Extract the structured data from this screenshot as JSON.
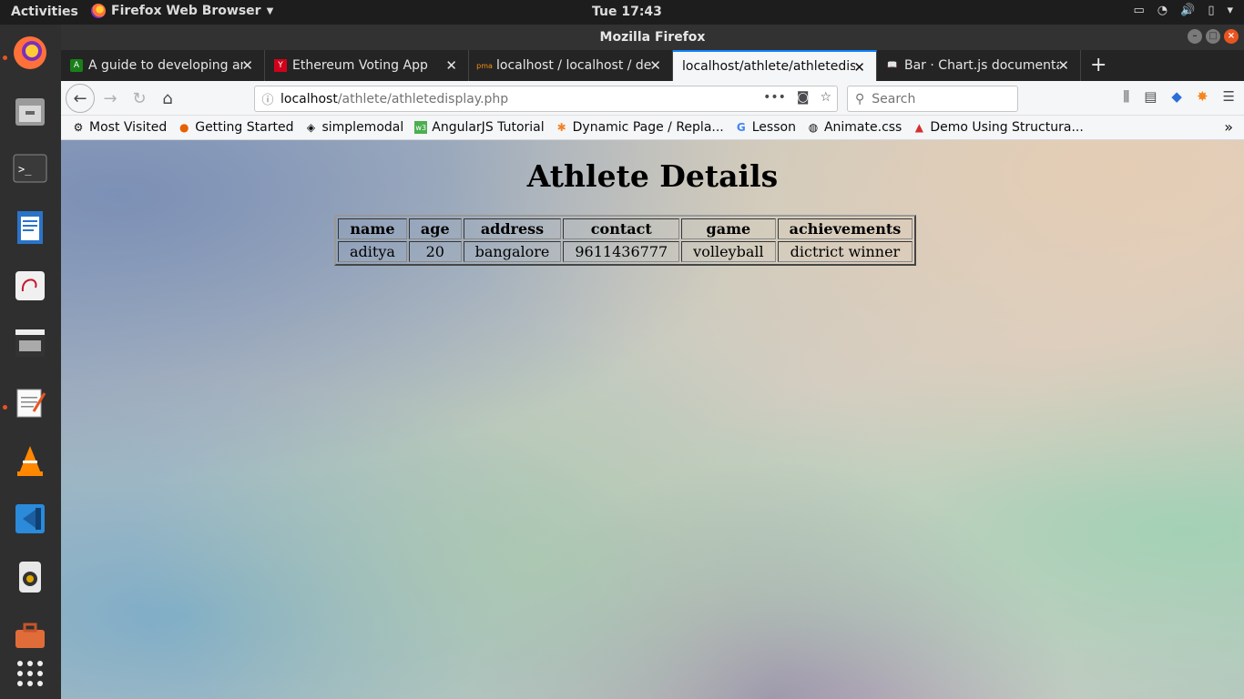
{
  "topbar": {
    "activities": "Activities",
    "app_menu": "Firefox Web Browser",
    "clock": "Tue 17:43"
  },
  "dock": {
    "apps": [
      "firefox-icon",
      "files-icon",
      "terminal-icon",
      "writer-icon",
      "document-viewer-icon",
      "video-editor-icon",
      "text-editor-icon",
      "vlc-icon",
      "vscode-icon",
      "speaker-icon",
      "toolbox-icon",
      "app-grid-icon"
    ]
  },
  "window": {
    "title": "Mozilla Firefox"
  },
  "tabs": [
    {
      "title": "A guide to developing an",
      "favicon": "A"
    },
    {
      "title": "Ethereum Voting App",
      "favicon": "Y"
    },
    {
      "title": "localhost / localhost / de",
      "favicon": "pma"
    },
    {
      "title": "localhost/athlete/athletedis",
      "favicon": "",
      "active": true
    },
    {
      "title": "Bar · Chart.js documenta",
      "favicon": "book"
    }
  ],
  "navbar": {
    "url_host": "localhost",
    "url_path": "/athlete/athletedisplay.php",
    "search_placeholder": "Search"
  },
  "bookmarks": [
    {
      "label": "Most Visited",
      "icon": "⚙"
    },
    {
      "label": "Getting Started",
      "icon": "●"
    },
    {
      "label": "simplemodal",
      "icon": "◈"
    },
    {
      "label": "AngularJS Tutorial",
      "icon": "w3"
    },
    {
      "label": "Dynamic Page / Repla...",
      "icon": "✱"
    },
    {
      "label": "Lesson",
      "icon": "G"
    },
    {
      "label": "Animate.css",
      "icon": "◍"
    },
    {
      "label": "Demo Using Structura...",
      "icon": "▲"
    }
  ],
  "page": {
    "heading": "Athlete Details",
    "table": {
      "headers": [
        "name",
        "age",
        "address",
        "contact",
        "game",
        "achievements"
      ],
      "rows": [
        [
          "aditya",
          "20",
          "bangalore",
          "9611436777",
          "volleyball",
          "dictrict winner"
        ]
      ]
    }
  }
}
